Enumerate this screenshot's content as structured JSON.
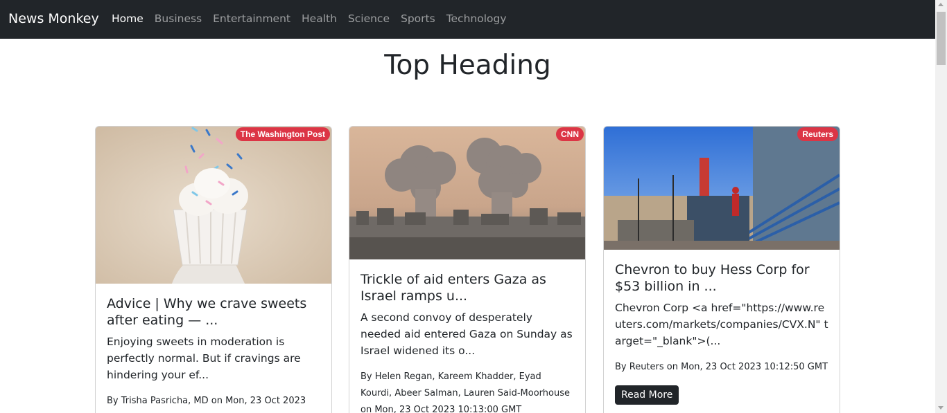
{
  "navbar": {
    "brand": "News Monkey",
    "links": [
      {
        "label": "Home",
        "active": true
      },
      {
        "label": "Business",
        "active": false
      },
      {
        "label": "Entertainment",
        "active": false
      },
      {
        "label": "Health",
        "active": false
      },
      {
        "label": "Science",
        "active": false
      },
      {
        "label": "Sports",
        "active": false
      },
      {
        "label": "Technology",
        "active": false
      }
    ]
  },
  "page": {
    "title": "Top Heading"
  },
  "articles": [
    {
      "source": "The Washington Post",
      "title": "Advice | Why we crave sweets after eating — ...",
      "description": "Enjoying sweets in moderation is perfectly normal. But if cravings are hindering your ef...",
      "meta": "By Trisha Pasricha, MD on Mon, 23 Oct 2023",
      "image": "ice-cream-cup-illustration"
    },
    {
      "source": "CNN",
      "title": "Trickle of aid enters Gaza as Israel ramps u...",
      "description": "A second convoy of desperately needed aid entered Gaza on Sunday as Israel widened its o...",
      "meta": "By Helen Regan, Kareem Khadder, Eyad Kourdi, Abeer Salman, Lauren Said-Moorhouse on Mon, 23 Oct 2023 10:13:00 GMT",
      "image": "smoke-over-city-photo"
    },
    {
      "source": "Reuters",
      "title": "Chevron to buy Hess Corp for $53 billion in ...",
      "description": "Chevron Corp <a href=\"https://www.reuters.com/markets/companies/CVX.N\" target=\"_blank\">(...",
      "meta": "By Reuters on Mon, 23 Oct 2023 10:12:50 GMT",
      "read_more": "Read More",
      "image": "oil-rig-worker-photo"
    }
  ],
  "colors": {
    "navbar_bg": "#212529",
    "badge_bg": "#dc3545",
    "button_bg": "#212529"
  }
}
